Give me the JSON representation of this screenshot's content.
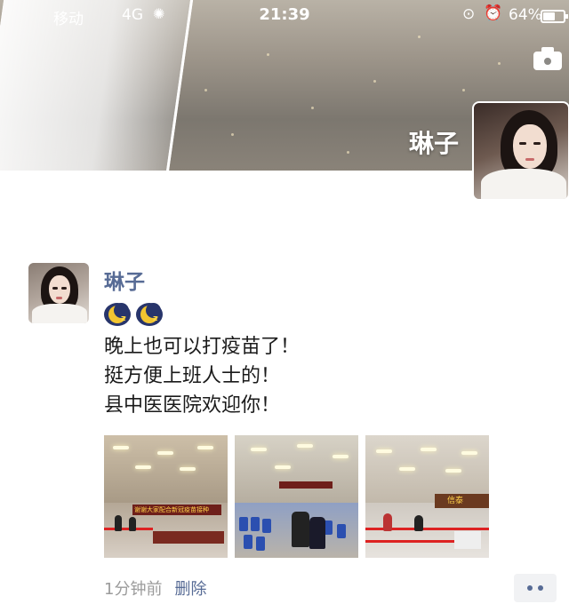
{
  "status_bar": {
    "carrier": "移动",
    "network": "4G",
    "time": "21:39",
    "battery_percent": "64%",
    "battery_level": 0.64
  },
  "cover": {
    "name": "琳子",
    "camera_icon": "camera-icon"
  },
  "post": {
    "author": "琳子",
    "emojis": [
      "moon-sleep-emoji",
      "moon-sleep-emoji"
    ],
    "lines": [
      "晚上也可以打疫苗了！",
      "挺方便上班人士的！",
      "县中医医院欢迎你！"
    ],
    "photo_count": 3,
    "photos": [
      {
        "banner_text": "谢谢大家配合新冠疫苗接种"
      },
      {
        "banner_text": ""
      },
      {
        "banner_text": "信泰"
      }
    ],
    "time_ago": "1分钟前",
    "delete_label": "删除"
  },
  "colors": {
    "link": "#576b95",
    "meta": "#9b9b9b",
    "text": "#1a1a1a"
  }
}
